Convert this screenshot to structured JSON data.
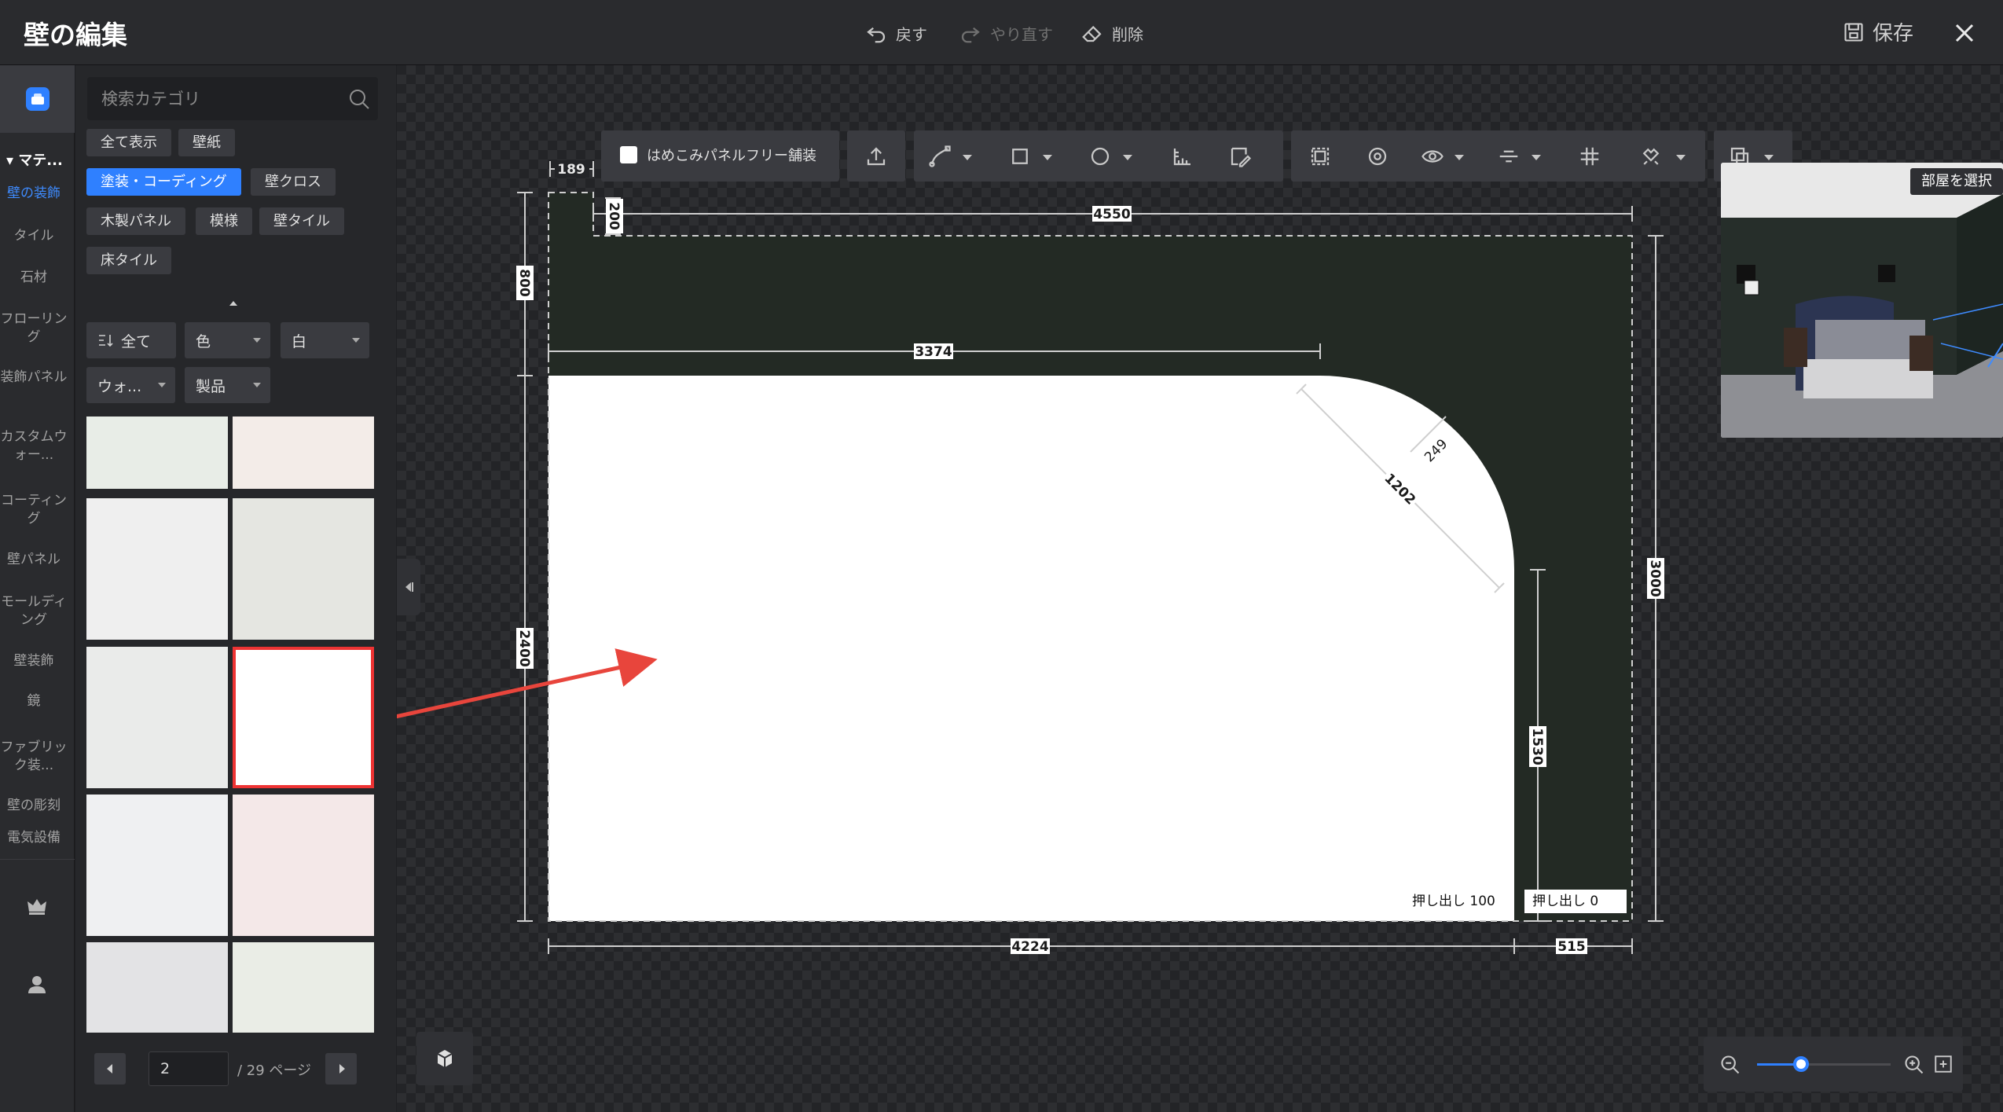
{
  "app": {
    "title": "壁の編集",
    "save_label": "保存"
  },
  "toolbar_actions": {
    "undo": "戻す",
    "redo": "やり直す",
    "delete": "削除"
  },
  "sidebar": {
    "section_label": "マテ...",
    "categories": [
      "壁の装飾",
      "タイル",
      "石材",
      "フローリング",
      "装飾パネル",
      "カスタムウォー...",
      "コーティング",
      "壁パネル",
      "モールディング",
      "壁装飾",
      "鏡",
      "ファブリック装...",
      "壁の彫刻",
      "電気設備"
    ],
    "active_index": 0
  },
  "panel": {
    "search_placeholder": "検索カテゴリ",
    "tags": [
      "全て表示",
      "壁紙",
      "塗装・コーディング",
      "壁クロス",
      "木製パネル",
      "模様",
      "壁タイル",
      "床タイル"
    ],
    "active_tag": "塗装・コーディング",
    "filters": {
      "sort": "全て",
      "attribute": "色",
      "color": "白",
      "scope": "ウォ...",
      "type": "製品"
    },
    "swatches": [
      "#e8ede7",
      "#f3ece8",
      "#efefef",
      "#e5e6e1",
      "#eaebea",
      "#ffffff",
      "#eff0f2",
      "#f4e8e8",
      "#e3e3e5",
      "#eaede6"
    ],
    "selected_swatch": 5,
    "pager": {
      "current_page": "2",
      "total_label": "/ 29 ページ"
    }
  },
  "canvas": {
    "free_paving_label": "はめこみパネルフリー舗装",
    "dimensions": [
      "189",
      "200",
      "4550",
      "800",
      "3374",
      "249",
      "1202",
      "3000",
      "2400",
      "1530",
      "4224",
      "515"
    ],
    "extrude_labels": [
      "押し出し 100",
      "押し出し 0"
    ],
    "wall_color": "#232a24",
    "opening_color": "#ffffff",
    "accent_color": "#2f80ff",
    "arrow_color": "#e8453c",
    "preview": {
      "room_select_label": "部屋を選択"
    },
    "zoom_level": 0.33
  }
}
